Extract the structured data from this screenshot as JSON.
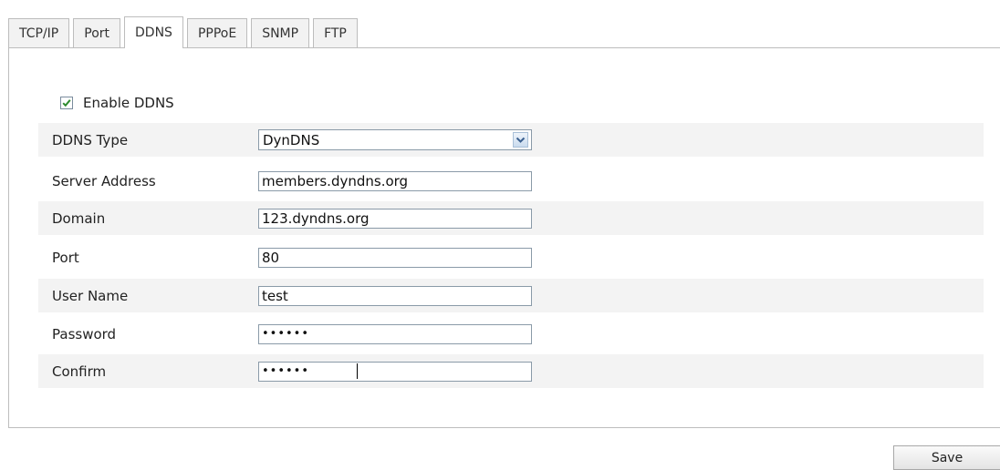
{
  "tabs": [
    {
      "label": "TCP/IP"
    },
    {
      "label": "Port"
    },
    {
      "label": "DDNS"
    },
    {
      "label": "PPPoE"
    },
    {
      "label": "SNMP"
    },
    {
      "label": "FTP"
    }
  ],
  "active_tab": "DDNS",
  "enable_ddns": {
    "label": "Enable DDNS",
    "checked": true
  },
  "form": {
    "ddns_type": {
      "label": "DDNS Type",
      "value": "DynDNS"
    },
    "server_address": {
      "label": "Server Address",
      "value": "members.dyndns.org"
    },
    "domain": {
      "label": "Domain",
      "value": "123.dyndns.org"
    },
    "port": {
      "label": "Port",
      "value": "80"
    },
    "user_name": {
      "label": "User Name",
      "value": "test"
    },
    "password": {
      "label": "Password",
      "value": "••••••"
    },
    "confirm": {
      "label": "Confirm",
      "value": "••••••"
    }
  },
  "save_label": "Save",
  "colors": {
    "check": "#2e8b2e",
    "row_shade": "#f3f3f3",
    "border": "#bdbdbd"
  }
}
